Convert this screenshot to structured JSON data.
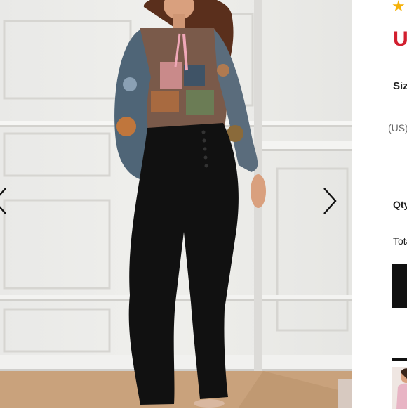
{
  "product_panel": {
    "price_fragment": "U",
    "size_label": "Siz",
    "size_unit": "(US)",
    "qty_label": "Qty",
    "total_label": "Tota"
  },
  "rating": {
    "icon": "star-icon"
  },
  "gallery": {
    "prev_icon": "chevron-left-icon",
    "next_icon": "chevron-right-icon"
  },
  "colors": {
    "price": "#d21f2f",
    "star": "#f5b20a",
    "button": "#111111",
    "wall": "#ecebe8",
    "floor": "#c9a27c"
  }
}
